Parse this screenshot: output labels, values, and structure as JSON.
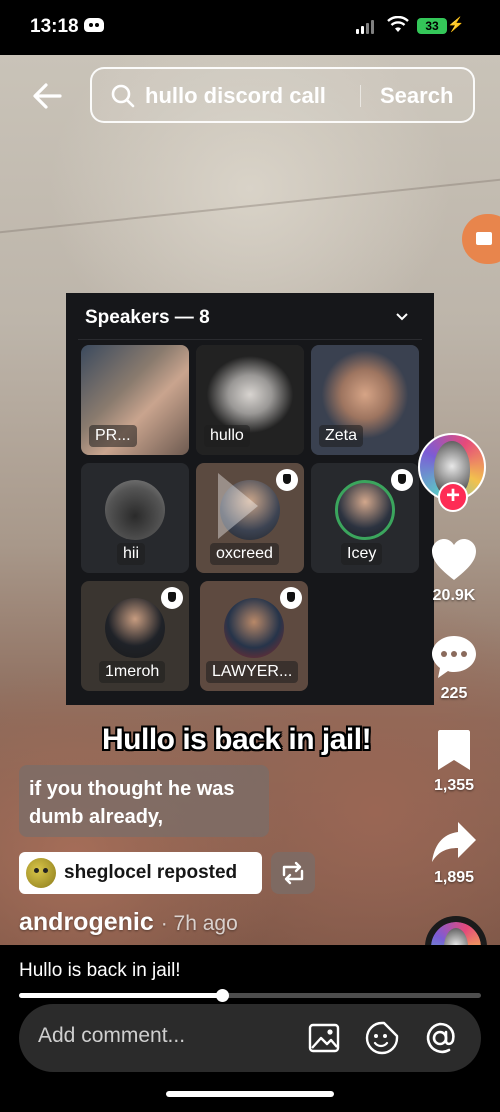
{
  "status_bar": {
    "time": "13:18",
    "battery": "33"
  },
  "search": {
    "query": "hullo discord call",
    "button_label": "Search"
  },
  "discord_panel": {
    "title": "Speakers — 8",
    "tiles": [
      {
        "name": "PR..."
      },
      {
        "name": "hullo"
      },
      {
        "name": "Zeta"
      },
      {
        "name": "hii"
      },
      {
        "name": "oxcreed"
      },
      {
        "name": "Icey"
      },
      {
        "name": "1meroh"
      },
      {
        "name": "LAWYER..."
      }
    ]
  },
  "rail": {
    "likes": "20.9K",
    "comments": "225",
    "saves": "1,355",
    "shares": "1,895"
  },
  "overlay": {
    "headline": "Hullo is back in jail!",
    "caption": "if you thought he was dumb already,"
  },
  "repost": {
    "text": "sheglocel reposted"
  },
  "author": {
    "name": "androgenic",
    "time": "· 7h ago"
  },
  "description": "Hullo is back in jail!",
  "progress": {
    "fraction": 0.44
  },
  "comment": {
    "placeholder": "Add comment..."
  },
  "colors": {
    "follow": "#fe2c55",
    "battery": "#34c759",
    "live": "#e8854c"
  }
}
